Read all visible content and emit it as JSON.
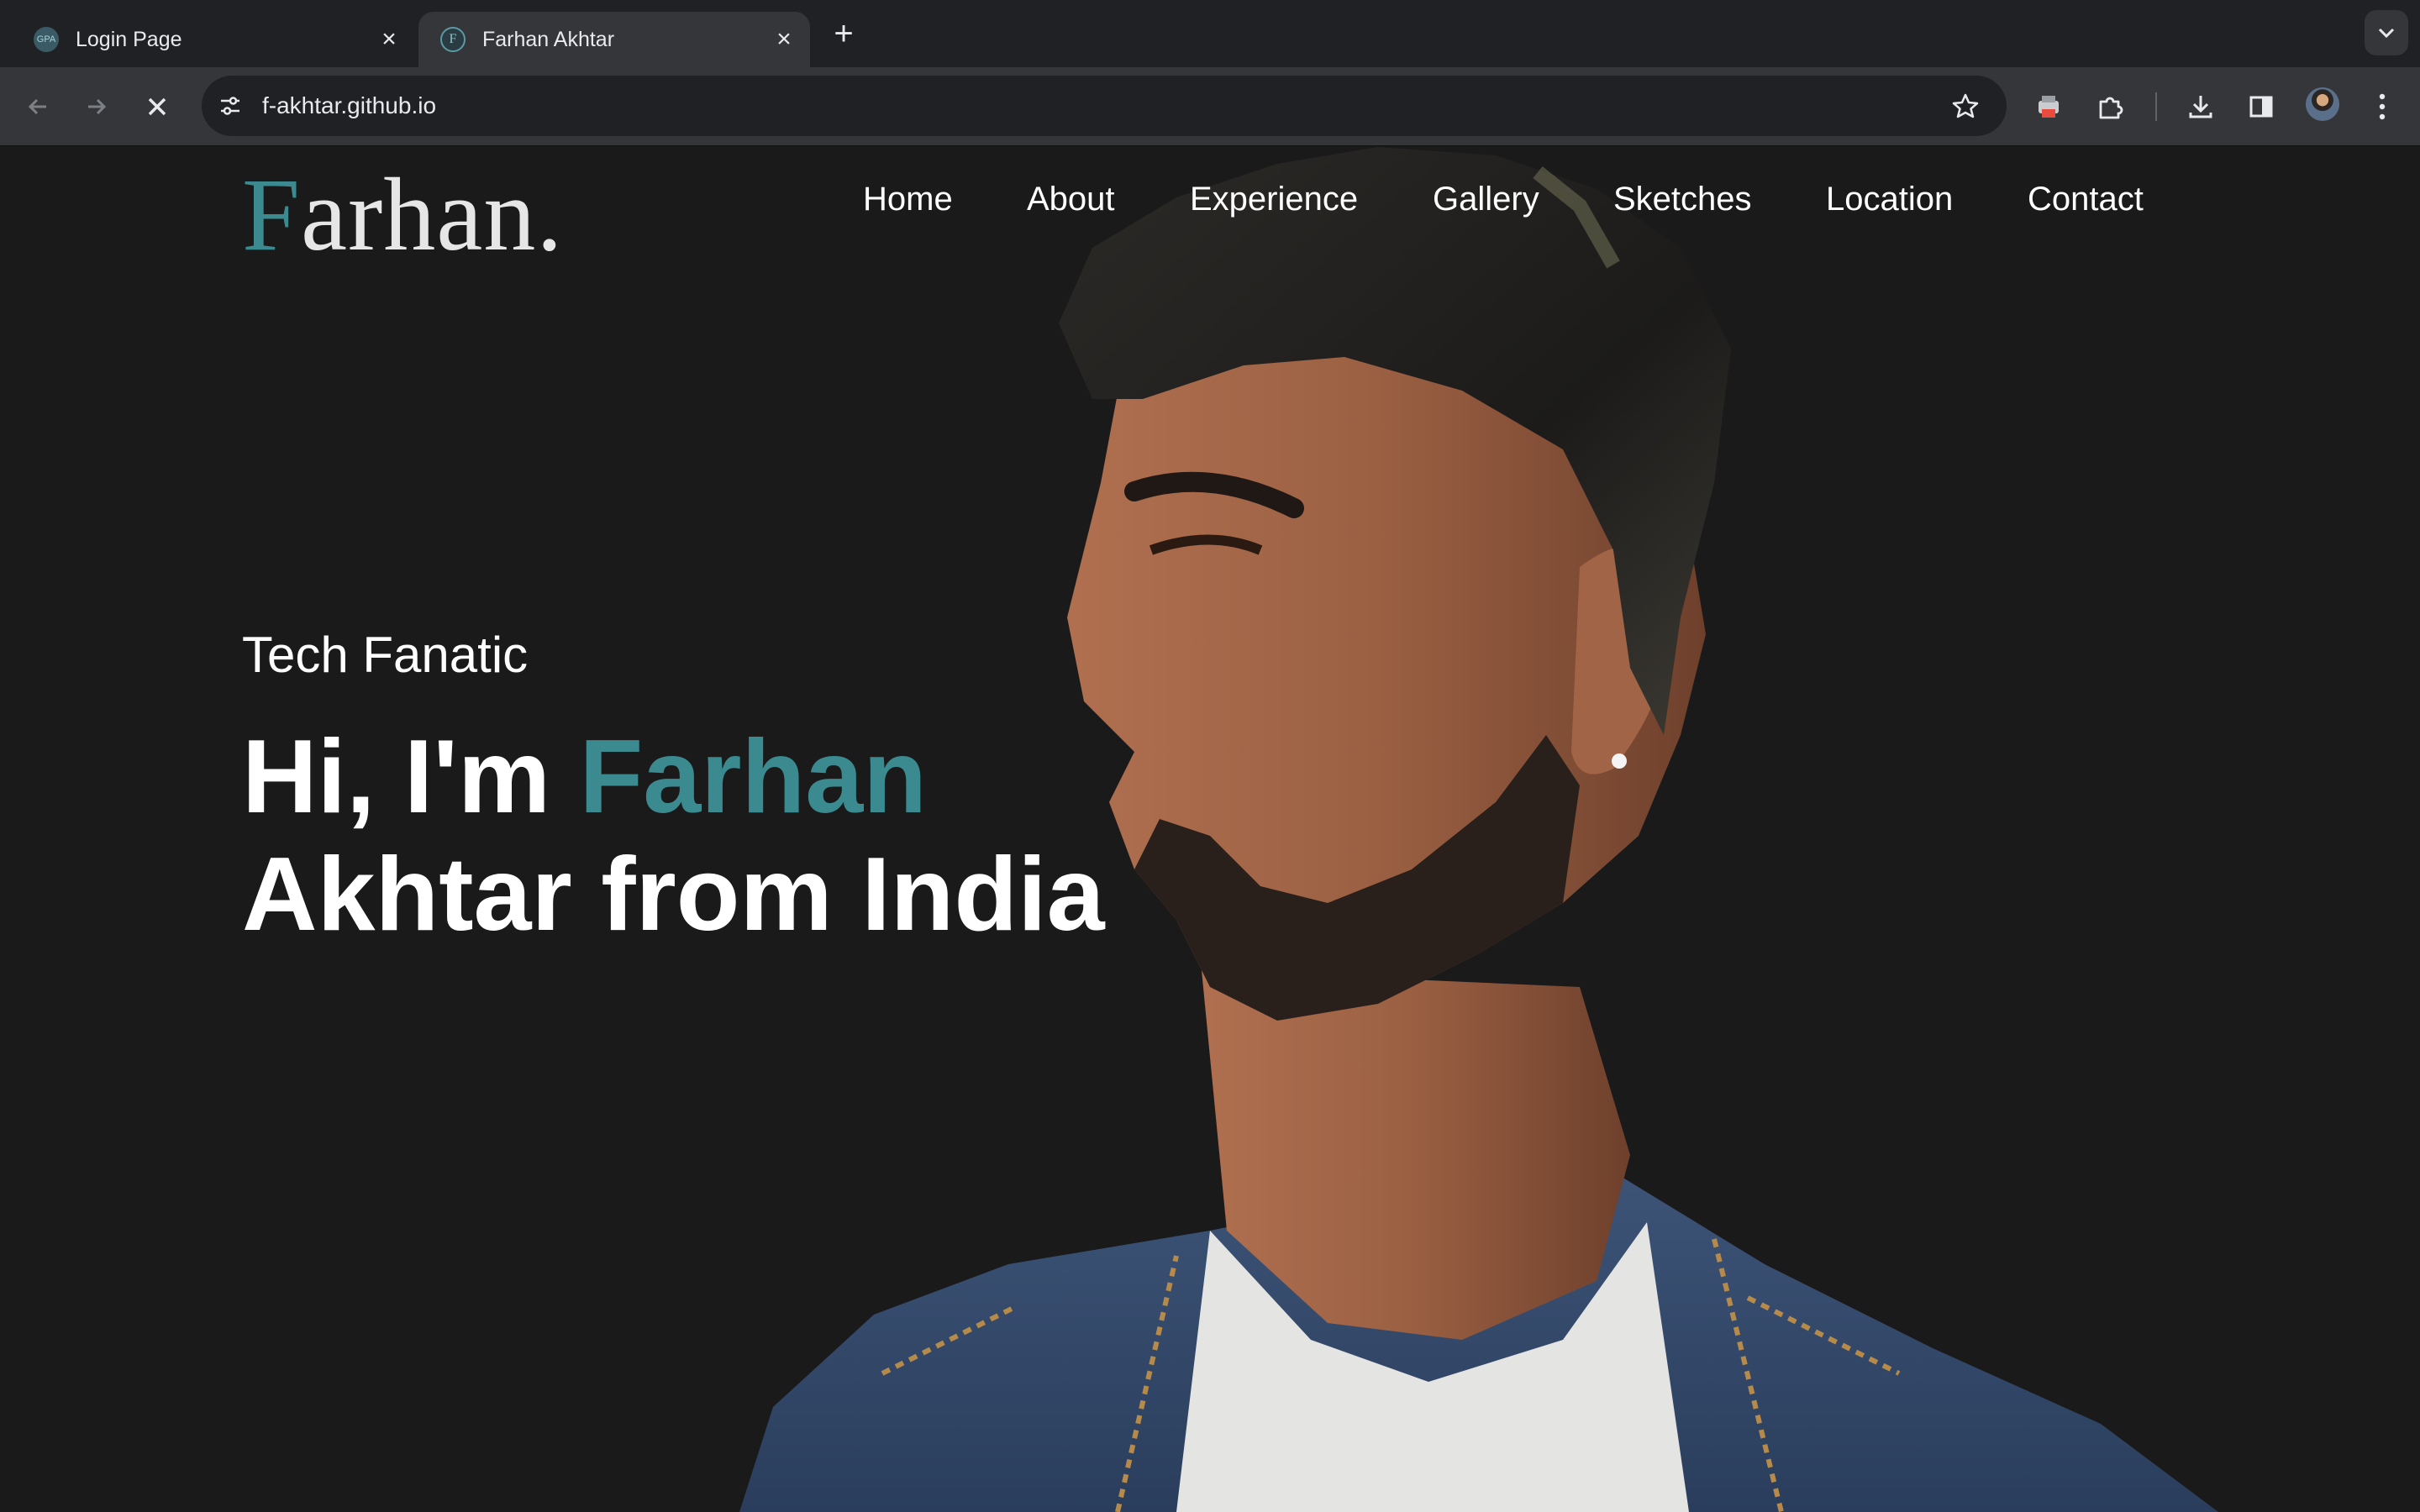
{
  "browser": {
    "tabs": [
      {
        "title": "Login Page",
        "favicon": "gpa-favicon",
        "active": false
      },
      {
        "title": "Farhan Akhtar",
        "favicon": "f-favicon",
        "active": true
      }
    ],
    "address": "f-akhtar.github.io",
    "icons": {
      "back": "back-arrow-icon",
      "forward": "forward-arrow-icon",
      "stop": "stop-loading-icon",
      "site_info": "site-info-icon",
      "bookmark": "star-icon",
      "extension_a": "printer-extension-icon",
      "extensions": "puzzle-piece-icon",
      "downloads": "download-icon",
      "side_panel": "side-panel-icon",
      "profile": "profile-avatar",
      "menu": "kebab-menu-icon"
    },
    "favicon_text": {
      "inactive": "GPA",
      "active": "F"
    }
  },
  "site": {
    "logo": {
      "initial": "F",
      "rest": "arhan."
    },
    "nav": [
      "Home",
      "About",
      "Experience",
      "Gallery",
      "Sketches",
      "Location",
      "Contact"
    ],
    "hero": {
      "tagline": "Tech Fanatic",
      "greeting": "Hi, I'm ",
      "first_name": "Farhan",
      "rest_line": "Akhtar from India"
    },
    "colors": {
      "accent": "#3a8a8f",
      "background": "#1a1a1b",
      "text": "#ffffff"
    }
  }
}
